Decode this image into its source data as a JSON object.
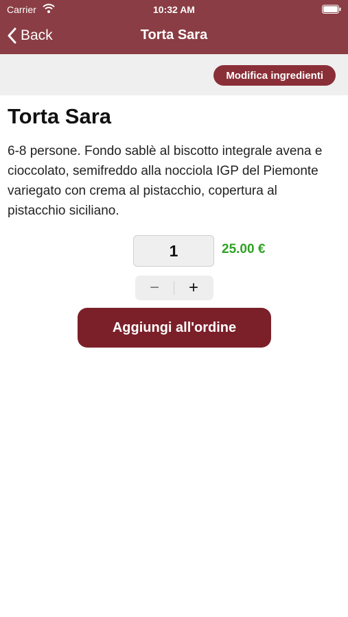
{
  "status": {
    "carrier": "Carrier",
    "time": "10:32 AM"
  },
  "nav": {
    "back_label": "Back",
    "title": "Torta Sara"
  },
  "toolbar": {
    "modify_label": "Modifica ingredienti"
  },
  "product": {
    "name": "Torta Sara",
    "description": "6-8 persone. Fondo sablè al biscotto integrale avena e cioccolato, semifreddo alla nocciola IGP del Piemonte variegato con crema al pistacchio, copertura al pistacchio siciliano.",
    "quantity": "1",
    "price": "25.00 €"
  },
  "stepper": {
    "minus": "−",
    "plus": "+"
  },
  "actions": {
    "add_label": "Aggiungi all'ordine"
  },
  "colors": {
    "header": "#8a3d44",
    "button": "#7b2029",
    "price": "#2ea323"
  }
}
